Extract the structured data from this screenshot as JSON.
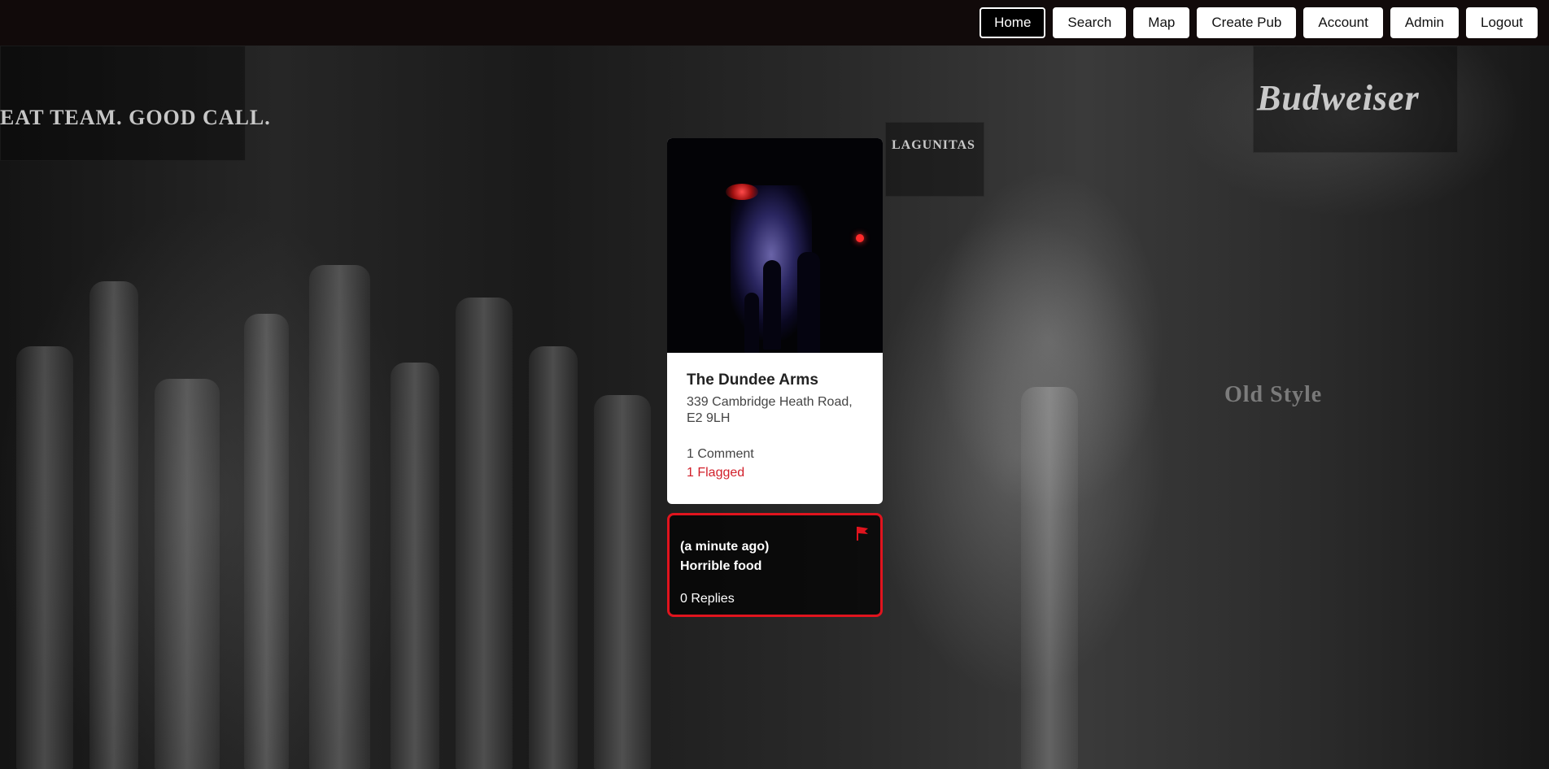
{
  "nav": {
    "items": [
      {
        "label": "Home",
        "active": true
      },
      {
        "label": "Search",
        "active": false
      },
      {
        "label": "Map",
        "active": false
      },
      {
        "label": "Create Pub",
        "active": false
      },
      {
        "label": "Account",
        "active": false
      },
      {
        "label": "Admin",
        "active": false
      },
      {
        "label": "Logout",
        "active": false
      }
    ]
  },
  "background": {
    "signs": [
      "EAT TEAM. GOOD CALL.",
      "Budweiser",
      "LAGUNITAS",
      "Old Style"
    ]
  },
  "pub": {
    "name": "The Dundee Arms",
    "address": "339 Cambridge Heath Road, E2 9LH",
    "comments_label": "1 Comment",
    "flagged_label": "1 Flagged"
  },
  "comment": {
    "time": "(a minute ago)",
    "text": "Horrible food",
    "replies_label": "0 Replies",
    "flag_icon": "flag-icon"
  },
  "colors": {
    "nav_bg": "#110a0a",
    "flag_red": "#e0141e",
    "flagged_text": "#d21f2a"
  }
}
